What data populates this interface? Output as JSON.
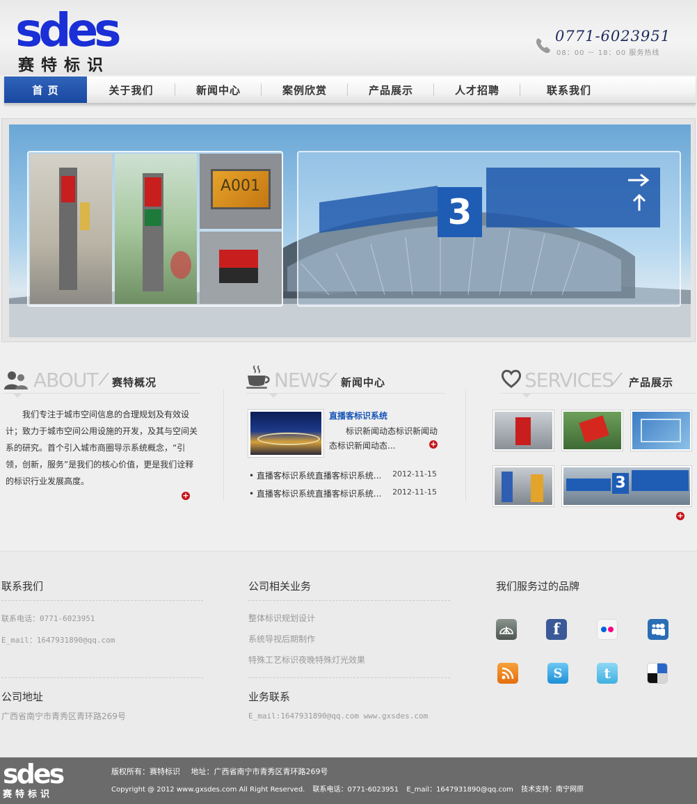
{
  "header": {
    "logo_en": "sdes",
    "logo_cn": "赛特标识",
    "phone": "0771-6023951",
    "hours": "08：00 － 18：00 服务热线"
  },
  "nav": {
    "items": [
      {
        "label": "首 页",
        "active": true
      },
      {
        "label": "关于我们",
        "active": false
      },
      {
        "label": "新闻中心",
        "active": false
      },
      {
        "label": "案例欣赏",
        "active": false
      },
      {
        "label": "产品展示",
        "active": false
      },
      {
        "label": "人才招聘",
        "active": false
      },
      {
        "label": "联系我们",
        "active": false
      }
    ]
  },
  "banner": {
    "sign_a": "A001",
    "sign_number": "3"
  },
  "about": {
    "title_en": "ABOUT",
    "title_cn": "赛特概况",
    "text": "我们专注于城市空间信息的合理规划及有效设计；致力于城市空间公用设施的开发，及其与空间关系的研究。首个引入城市商圈导示系统概念，“引领，创新，服务”是我们的核心价值，更是我们诠释的标识行业发展高度。"
  },
  "news": {
    "title_en": "NEWS",
    "title_cn": "新闻中心",
    "featured_title": "直播客标识系统",
    "featured_summary": "标识新闻动态标识新闻动态标识新闻动态...",
    "items": [
      {
        "title": "• 直播客标识系统直播客标识系统...",
        "date": "2012-11-15"
      },
      {
        "title": "• 直播客标识系统直播客标识系统...",
        "date": "2012-11-15"
      }
    ]
  },
  "services": {
    "title_en": "SERVICES",
    "title_cn": "产品展示",
    "sign_number": "3"
  },
  "contact": {
    "title": "联系我们",
    "phone": "联系电话：0771-6023951",
    "email": "E_mail：1647931890@qq.com",
    "address_title": "公司地址",
    "address": "广西省南宁市青秀区青环路269号"
  },
  "business": {
    "title": "公司相关业务",
    "items": [
      "整体标识规划设计",
      "系统导视后期制作",
      "特殊工艺标识夜晚特殊灯光效果"
    ],
    "contact_title": "业务联系",
    "contact_line": "E_mail:1647931890@qq.com   www.gxsdes.com"
  },
  "brands": {
    "title": "我们服务过的品牌",
    "icons": [
      "delicious-icon",
      "facebook-icon",
      "flickr-icon",
      "myspace-icon",
      "rss-icon",
      "skype-icon",
      "twitter-icon",
      "delicious-square-icon"
    ]
  },
  "footer": {
    "logo_en": "sdes",
    "logo_cn": "赛特标识",
    "copyright_label": "版权所有：赛特标识",
    "address_label": "地址：广西省南宁市青秀区青环路269号",
    "copyright": "Copyright @ 2012  www.gxsdes.com All Right Reserved.",
    "phone": "联系电话：0771-6023951",
    "email": "E_mail：1647931890@qq.com",
    "support": "技术支持：南宁网原"
  },
  "colors": {
    "brand_blue": "#1a48a0",
    "accent_red": "#c4161c",
    "link_blue": "#1956b8"
  }
}
